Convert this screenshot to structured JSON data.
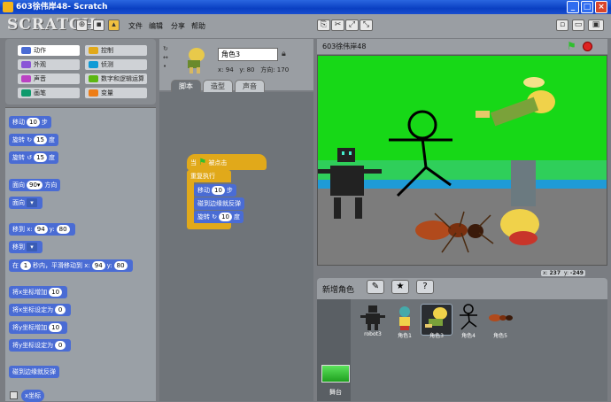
{
  "window": {
    "title": "603徐伟岸48- Scratch",
    "minimize": "_",
    "maximize": "□",
    "close": "×"
  },
  "app": {
    "logo": "SCRATCH"
  },
  "menu": [
    "文件",
    "编辑",
    "分享",
    "帮助"
  ],
  "categories": [
    {
      "label": "动作",
      "color": "#4a6cd4",
      "selected": true
    },
    {
      "label": "控制",
      "color": "#e1a91a"
    },
    {
      "label": "外观",
      "color": "#8a55d7"
    },
    {
      "label": "侦测",
      "color": "#0e9ad6"
    },
    {
      "label": "声音",
      "color": "#bb42c3"
    },
    {
      "label": "数字和逻辑运算",
      "color": "#5cb712"
    },
    {
      "label": "画笔",
      "color": "#0e9a6c"
    },
    {
      "label": "变量",
      "color": "#ee7d16"
    }
  ],
  "palette": {
    "move": {
      "pre": "移动",
      "val": "10",
      "post": "步"
    },
    "turn_right": {
      "pre": "旋转 ↻",
      "val": "15",
      "post": "度"
    },
    "turn_left": {
      "pre": "旋转 ↺",
      "val": "15",
      "post": "度"
    },
    "point_dir": {
      "pre": "面向",
      "val": "90▾",
      "post": "方向"
    },
    "point_towards": {
      "pre": "面向",
      "val": "▾"
    },
    "goto_xy": {
      "pre": "移到 x:",
      "x": "94",
      "ylbl": "y:",
      "y": "80"
    },
    "goto": {
      "pre": "移到",
      "val": "▾"
    },
    "glide": {
      "pre": "在",
      "secs": "1",
      "mid": "秒内，平滑移动到 x:",
      "x": "94",
      "ylbl": "y:",
      "y": "80"
    },
    "change_x": {
      "pre": "将x坐标增加",
      "val": "10"
    },
    "set_x": {
      "pre": "将x坐标设定为",
      "val": "0"
    },
    "change_y": {
      "pre": "将y坐标增加",
      "val": "10"
    },
    "set_y": {
      "pre": "将y坐标设定为",
      "val": "0"
    },
    "bounce": "碰到边缘就反弹",
    "x_position": "x坐标"
  },
  "sprite": {
    "name": "角色3",
    "x_label": "x:",
    "x": "94",
    "y_label": "y:",
    "y": "80",
    "dir_label": "方向:",
    "dir": "170"
  },
  "tabs": [
    {
      "label": "脚本",
      "selected": true
    },
    {
      "label": "造型"
    },
    {
      "label": "声音"
    }
  ],
  "script": {
    "hat_pre": "当",
    "hat_post": "被点击",
    "forever": "重复执行",
    "move_pre": "移动",
    "move_val": "10",
    "move_post": "步",
    "bounce": "碰到边缘就反弹",
    "turn_pre": "旋转 ↻",
    "turn_val": "10",
    "turn_post": "度"
  },
  "stage": {
    "title": "603徐伟岸48",
    "mouse_x_label": "x:",
    "mouse_x": "237",
    "mouse_y_label": "y:",
    "mouse_y": "-249"
  },
  "sprite_list": {
    "label": "新增角色",
    "sprites": [
      {
        "name": "robot3"
      },
      {
        "name": "角色1"
      },
      {
        "name": "角色3",
        "selected": true
      },
      {
        "name": "角色4"
      },
      {
        "name": "角色5"
      }
    ],
    "stage_label": "舞台"
  }
}
